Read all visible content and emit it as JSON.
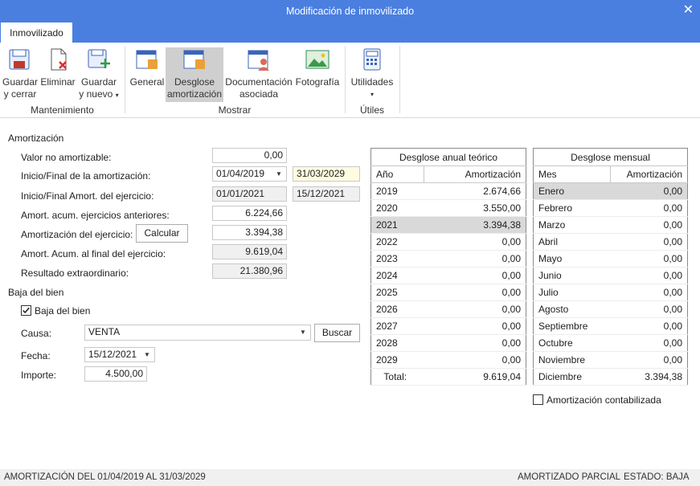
{
  "window": {
    "title": "Modificación de inmovilizado",
    "close": "✕"
  },
  "tabs": [
    {
      "label": "Inmovilizado"
    }
  ],
  "ribbon": {
    "groups": {
      "mantenimiento": "Mantenimiento",
      "mostrar": "Mostrar",
      "utiles": "Útiles"
    },
    "buttons": {
      "guardar_cerrar": [
        "Guardar",
        "y cerrar"
      ],
      "eliminar": "Eliminar",
      "guardar_nuevo": [
        "Guardar",
        "y nuevo"
      ],
      "general": "General",
      "desglose": [
        "Desglose",
        "amortización"
      ],
      "documentacion": [
        "Documentación",
        "asociada"
      ],
      "fotografia": "Fotografía",
      "utilidades": "Utilidades"
    }
  },
  "amortizacion": {
    "section_title": "Amortización",
    "valor_no_amortizable": {
      "label": "Valor no amortizable:",
      "value": "0,00"
    },
    "inicio_final": {
      "label": "Inicio/Final de la amortización:",
      "inicio": "01/04/2019",
      "final": "31/03/2029"
    },
    "inicio_final_ejercicio": {
      "label": "Inicio/Final Amort. del ejercicio:",
      "inicio": "01/01/2021",
      "final": "15/12/2021"
    },
    "acum_anteriores": {
      "label": "Amort. acum. ejercicios anteriores:",
      "value": "6.224,66"
    },
    "del_ejercicio": {
      "label": "Amortización del ejercicio:",
      "value": "3.394,38",
      "button": "Calcular"
    },
    "acum_final": {
      "label": "Amort. Acum. al final del ejercicio:",
      "value": "9.619,04"
    },
    "resultado": {
      "label": "Resultado extraordinario:",
      "value": "21.380,96"
    }
  },
  "baja": {
    "section_title": "Baja del bien",
    "checkbox": {
      "label": "Baja del bien",
      "checked": true
    },
    "causa": {
      "label": "Causa:",
      "value": "VENTA",
      "button": "Buscar"
    },
    "fecha": {
      "label": "Fecha:",
      "value": "15/12/2021"
    },
    "importe": {
      "label": "Importe:",
      "value": "4.500,00"
    }
  },
  "anual": {
    "caption": "Desglose anual teórico",
    "col_year": "Año",
    "col_amount": "Amortización",
    "rows": [
      {
        "year": "2019",
        "amount": "2.674,66"
      },
      {
        "year": "2020",
        "amount": "3.550,00"
      },
      {
        "year": "2021",
        "amount": "3.394,38"
      },
      {
        "year": "2022",
        "amount": "0,00"
      },
      {
        "year": "2023",
        "amount": "0,00"
      },
      {
        "year": "2024",
        "amount": "0,00"
      },
      {
        "year": "2025",
        "amount": "0,00"
      },
      {
        "year": "2026",
        "amount": "0,00"
      },
      {
        "year": "2027",
        "amount": "0,00"
      },
      {
        "year": "2028",
        "amount": "0,00"
      },
      {
        "year": "2029",
        "amount": "0,00"
      }
    ],
    "selected_row": 2,
    "total_label": "Total:",
    "total": "9.619,04"
  },
  "mensual": {
    "caption": "Desglose mensual",
    "col_month": "Mes",
    "col_amount": "Amortización",
    "rows": [
      {
        "month": "Enero",
        "amount": "0,00"
      },
      {
        "month": "Febrero",
        "amount": "0,00"
      },
      {
        "month": "Marzo",
        "amount": "0,00"
      },
      {
        "month": "Abril",
        "amount": "0,00"
      },
      {
        "month": "Mayo",
        "amount": "0,00"
      },
      {
        "month": "Junio",
        "amount": "0,00"
      },
      {
        "month": "Julio",
        "amount": "0,00"
      },
      {
        "month": "Agosto",
        "amount": "0,00"
      },
      {
        "month": "Septiembre",
        "amount": "0,00"
      },
      {
        "month": "Octubre",
        "amount": "0,00"
      },
      {
        "month": "Noviembre",
        "amount": "0,00"
      },
      {
        "month": "Diciembre",
        "amount": "3.394,38"
      }
    ],
    "selected_row": 0,
    "contabilizada": {
      "label": "Amortización contabilizada",
      "checked": false
    }
  },
  "status": {
    "left": "AMORTIZACIÓN DEL 01/04/2019 AL 31/03/2029",
    "middle": "AMORTIZADO PARCIAL",
    "right": "ESTADO: BAJA"
  },
  "colors": {
    "accent": "#4a7fe0",
    "selected_row": "#d9d9d9"
  }
}
